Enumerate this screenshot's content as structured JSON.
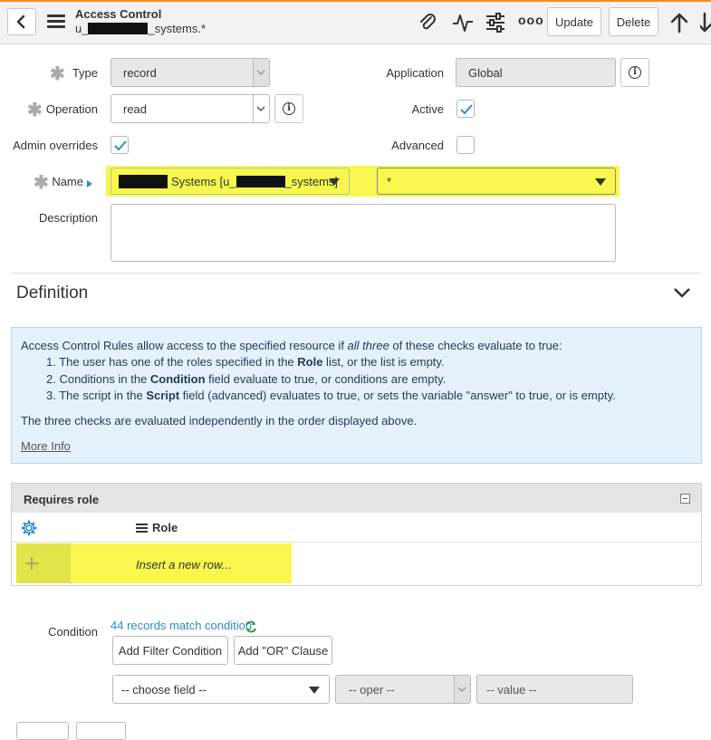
{
  "header": {
    "title": "Access Control",
    "subtitle_prefix": "u_",
    "subtitle_suffix": "_systems.*",
    "update_label": "Update",
    "delete_label": "Delete",
    "more_label": "ooo"
  },
  "form": {
    "type_label": "Type",
    "type_value": "record",
    "operation_label": "Operation",
    "operation_value": "read",
    "admin_overrides_label": "Admin overrides",
    "application_label": "Application",
    "application_value": "Global",
    "active_label": "Active",
    "advanced_label": "Advanced",
    "name_label": "Name",
    "name_table_value": "Systems [u_",
    "name_table_suffix": "_systems]",
    "name_field_value": "*",
    "description_label": "Description",
    "admin_overrides_checked": true,
    "active_checked": true,
    "advanced_checked": false
  },
  "definition": {
    "title": "Definition",
    "intro_a": "Access Control Rules allow access to the specified resource if ",
    "intro_em": "all three",
    "intro_b": " of these checks evaluate to true:",
    "item1_a": "1. The user has one of the roles specified in the ",
    "item1_b": "Role",
    "item1_c": " list, or the list is empty.",
    "item2_a": "2. Conditions in the ",
    "item2_b": "Condition",
    "item2_c": " field evaluate to true, or conditions are empty.",
    "item3_a": "3. The script in the ",
    "item3_b": "Script",
    "item3_c": " field (advanced) evaluates to true, or sets the variable \"answer\" to true, or is empty.",
    "footer": "The three checks are evaluated independently in the order displayed above.",
    "more_info": "More Info"
  },
  "roles": {
    "title": "Requires role",
    "column": "Role",
    "insert_row": "Insert a new row..."
  },
  "condition": {
    "label": "Condition",
    "match_text": "44 records match condition",
    "add_filter": "Add Filter Condition",
    "add_or": "Add \"OR\" Clause",
    "field_placeholder": "-- choose field --",
    "oper_placeholder": "-- oper --",
    "value_placeholder": "-- value --"
  },
  "colors": {
    "accent_top": "#f08c24",
    "highlight": "#f7f74d",
    "info_bg": "#e5f1fb",
    "link": "#2b8bc8",
    "check": "#2b8bc8"
  }
}
